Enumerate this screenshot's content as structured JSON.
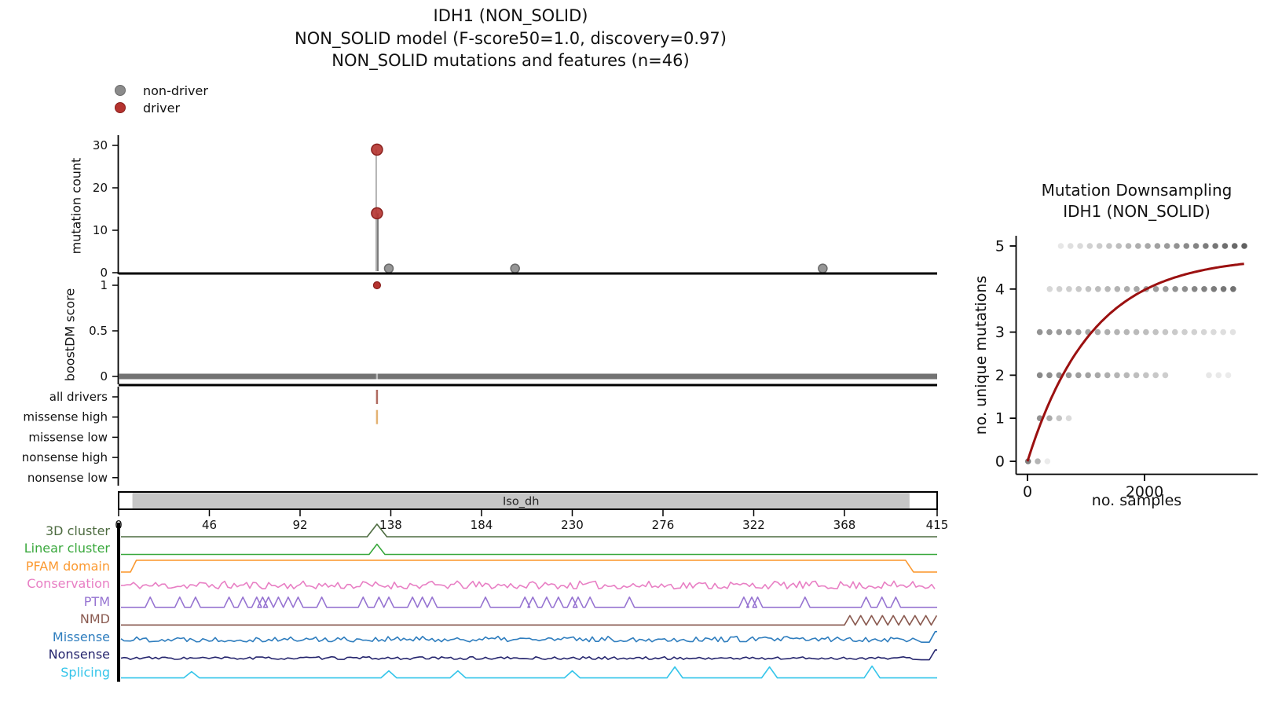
{
  "title": {
    "line1": "IDH1 (NON_SOLID)",
    "line2": "NON_SOLID model (F-score50=1.0, discovery=0.97)",
    "line3": "NON_SOLID mutations and features (n=46)"
  },
  "legend": {
    "items": [
      {
        "label": "non-driver",
        "color": "#8b8b8b",
        "edge": "#6a6a6a"
      },
      {
        "label": "driver",
        "color": "#b5332f",
        "edge": "#891f1c"
      }
    ]
  },
  "chart_data": [
    {
      "id": "needle-plot",
      "type": "scatter",
      "ylabel": "mutation count",
      "yticks": [
        0,
        10,
        20,
        30
      ],
      "ylim": [
        0,
        32
      ],
      "xlim": [
        0,
        415
      ],
      "points": [
        {
          "pos": 131,
          "count": 29,
          "class": "driver"
        },
        {
          "pos": 131,
          "count": 14,
          "class": "driver"
        },
        {
          "pos": 137,
          "count": 1,
          "class": "non-driver"
        },
        {
          "pos": 201,
          "count": 1,
          "class": "non-driver"
        },
        {
          "pos": 357,
          "count": 1,
          "class": "non-driver"
        }
      ],
      "stem_colors": [
        "#b3b3b3",
        "#7d7d7d"
      ]
    },
    {
      "id": "boostdm-score",
      "type": "scatter",
      "ylabel": "boostDM score",
      "yticks": [
        0,
        0.5,
        1
      ],
      "ylim": [
        0,
        1
      ],
      "driver_points": [
        {
          "pos": 131,
          "score": 1.0
        }
      ],
      "nondriver_band": {
        "score": 0.02,
        "from": 0,
        "to": 415,
        "color": "#737373",
        "notch_pos": 131
      }
    },
    {
      "id": "consequence-tracks",
      "type": "ticks",
      "rows": [
        "all drivers",
        "missense high",
        "missense low",
        "nonsense high",
        "nonsense low"
      ],
      "marks": [
        {
          "row": "all drivers",
          "pos": 131,
          "color": "#b06a60"
        },
        {
          "row": "missense high",
          "pos": 131,
          "color": "#e3b273"
        }
      ]
    },
    {
      "id": "protein-domain-bar",
      "type": "domain-bar",
      "protein_length": 415,
      "xticks": [
        0,
        46,
        92,
        138,
        184,
        230,
        276,
        322,
        368,
        415
      ],
      "domains": [
        {
          "label": "Iso_dh",
          "start": 7,
          "end": 401,
          "color": "#c6c6c6"
        }
      ]
    },
    {
      "id": "feature-tracks",
      "type": "line-tracks",
      "tracks": [
        {
          "name": "3D cluster",
          "color": "#4d6b40",
          "kind": "peaks",
          "peak_h": 16,
          "peak_w": 5,
          "peaks": [
            131
          ]
        },
        {
          "name": "Linear cluster",
          "color": "#39a83c",
          "kind": "peaks",
          "peak_h": 13,
          "peak_w": 4,
          "peaks": [
            131
          ]
        },
        {
          "name": "PFAM domain",
          "color": "#fb9a32",
          "kind": "step",
          "start": 7,
          "end": 401,
          "h": 15
        },
        {
          "name": "Conservation",
          "color": "#e87fc4",
          "kind": "noise",
          "amp": 10,
          "seed": 11
        },
        {
          "name": "PTM",
          "color": "#9673d1",
          "kind": "peaks",
          "peak_h": 13,
          "peak_w": 2.5,
          "peaks": [
            16,
            31,
            39,
            56,
            63,
            70,
            73,
            76,
            81,
            86,
            91,
            103,
            124,
            132,
            137,
            149,
            154,
            159,
            186,
            206,
            210,
            217,
            223,
            230,
            233,
            239,
            259,
            317,
            321,
            324,
            348,
            379,
            387,
            394
          ]
        },
        {
          "name": "NMD",
          "color": "#8a5a50",
          "kind": "endwave",
          "wave_start": 368,
          "h": 12,
          "period": 5.5
        },
        {
          "name": "Missense",
          "color": "#2e7dbe",
          "kind": "noise",
          "amp": 7,
          "seed": 22,
          "end_spike": 14
        },
        {
          "name": "Nonsense",
          "color": "#26266e",
          "kind": "noise",
          "amp": 3.5,
          "seed": 33,
          "end_spike": 13
        },
        {
          "name": "Splicing",
          "color": "#35c5ea",
          "kind": "peaks",
          "peak_w": 4,
          "peaks": [
            37,
            137,
            172,
            230,
            282,
            330,
            382
          ],
          "peak_heights": [
            8,
            9,
            9,
            9,
            14,
            14,
            15
          ]
        }
      ]
    },
    {
      "id": "mutation-downsampling",
      "type": "scatter+curve",
      "title_line1": "Mutation Downsampling",
      "title_line2": "IDH1 (NON_SOLID)",
      "xlabel": "no. samples",
      "ylabel": "no. unique mutations",
      "xticks": [
        0,
        2000
      ],
      "yticks": [
        0,
        1,
        2,
        3,
        4,
        5
      ],
      "xlim": [
        0,
        3700
      ],
      "ylim": [
        0,
        5
      ],
      "curve": {
        "color": "#9b1010",
        "amplitude": 4.75,
        "tau": 1100
      },
      "dot_color": "#3a3a3a",
      "dot_rows": [
        {
          "y": 5,
          "start": 570,
          "step": 165,
          "count": 20,
          "op_from": 0.12,
          "op_to": 0.8
        },
        {
          "y": 4,
          "start": 380,
          "step": 165,
          "count": 20,
          "op_from": 0.2,
          "op_to": 0.72
        },
        {
          "y": 3,
          "start": 210,
          "step": 165,
          "count": 21,
          "op_from": 0.55,
          "op_to": 0.15
        },
        {
          "y": 2,
          "start": 210,
          "step": 165,
          "count": 14,
          "op_from": 0.6,
          "op_to": 0.25
        },
        {
          "y": 2,
          "start": 3100,
          "step": 165,
          "count": 3,
          "op_from": 0.12,
          "op_to": 0.1
        },
        {
          "y": 1,
          "start": 210,
          "step": 165,
          "count": 4,
          "op_from": 0.55,
          "op_to": 0.18
        },
        {
          "y": 0,
          "start": 10,
          "step": 165,
          "count": 3,
          "op_from": 0.65,
          "op_to": 0.1
        }
      ]
    }
  ]
}
